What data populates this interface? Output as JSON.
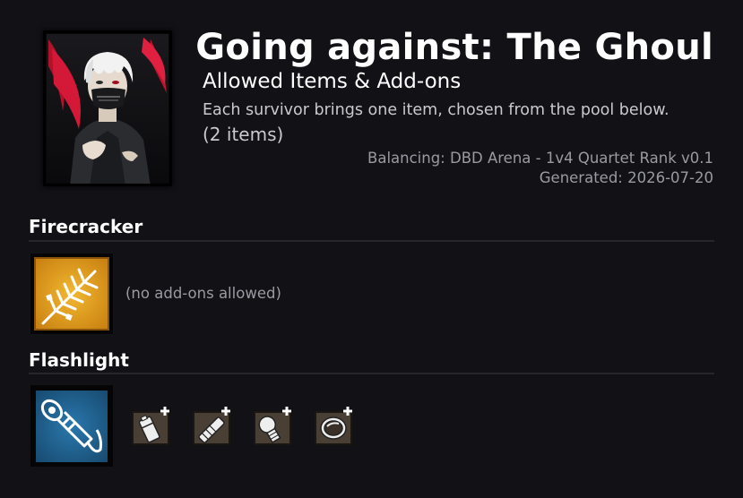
{
  "header": {
    "title": "Going against: The Ghoul",
    "subtitle": "Allowed Items & Add-ons",
    "description": "Each survivor brings one item, chosen from the pool below.",
    "count": "(2 items)",
    "balancing": "Balancing: DBD Arena - 1v4 Quartet Rank v0.1",
    "generated": "Generated: 2026-07-20"
  },
  "portrait": {
    "icon": "killer-portrait-ghoul"
  },
  "items": [
    {
      "name": "Firecracker",
      "icon": "firecracker-icon",
      "color": "#e0a020",
      "addons_note": "(no add-ons allowed)",
      "addons": []
    },
    {
      "name": "Flashlight",
      "icon": "flashlight-icon",
      "color": "#1e5f8e",
      "addons": [
        {
          "icon": "battery-addon-icon"
        },
        {
          "icon": "handle-addon-icon"
        },
        {
          "icon": "bulb-addon-icon"
        },
        {
          "icon": "lens-addon-icon"
        }
      ]
    }
  ],
  "colors": {
    "background": "#111116",
    "text": "#ffffff",
    "muted": "#9a9aa2",
    "addon_tile": "#4a3f35"
  }
}
